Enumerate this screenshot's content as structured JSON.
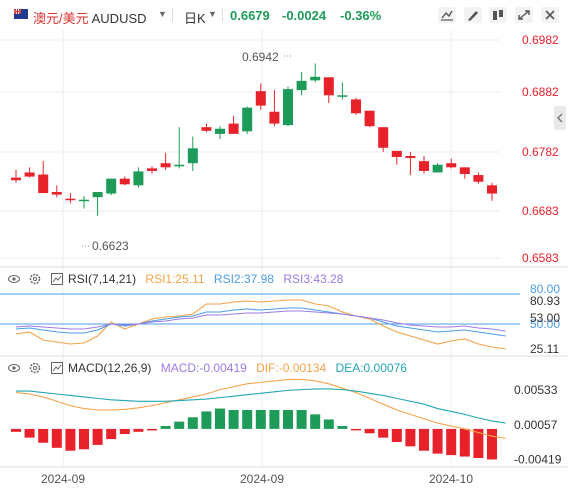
{
  "header": {
    "pair_cn": "澳元/美元",
    "pair_code": "AUDUSD",
    "period": "日K",
    "last": "0.6679",
    "change": "-0.0024",
    "change_pct": "-0.36%"
  },
  "colors": {
    "up": "#1e9b58",
    "down": "#e8222b",
    "grid": "#eeeeee"
  },
  "chart_data": [
    {
      "type": "candlestick",
      "title": "",
      "y_ticks": [
        "0.6982",
        "0.6882",
        "0.6782",
        "0.6683",
        "0.6583"
      ],
      "ylim": [
        0.6556,
        0.7003
      ],
      "annotations": {
        "high": "0.6942",
        "low": "0.6623"
      },
      "candles": [
        {
          "o": 0.672,
          "h": 0.6735,
          "l": 0.671,
          "c": 0.6715
        },
        {
          "o": 0.673,
          "h": 0.674,
          "l": 0.672,
          "c": 0.6722
        },
        {
          "o": 0.6726,
          "h": 0.6752,
          "l": 0.6715,
          "c": 0.669
        },
        {
          "o": 0.6692,
          "h": 0.6705,
          "l": 0.6682,
          "c": 0.6687
        },
        {
          "o": 0.6679,
          "h": 0.669,
          "l": 0.667,
          "c": 0.6678
        },
        {
          "o": 0.6675,
          "h": 0.6684,
          "l": 0.666,
          "c": 0.6677
        },
        {
          "o": 0.6682,
          "h": 0.669,
          "l": 0.6646,
          "c": 0.6692
        },
        {
          "o": 0.6689,
          "h": 0.6718,
          "l": 0.6686,
          "c": 0.6718
        },
        {
          "o": 0.6718,
          "h": 0.6722,
          "l": 0.6705,
          "c": 0.6707
        },
        {
          "o": 0.6705,
          "h": 0.674,
          "l": 0.67,
          "c": 0.6732
        },
        {
          "o": 0.6738,
          "h": 0.6742,
          "l": 0.6728,
          "c": 0.6733
        },
        {
          "o": 0.6748,
          "h": 0.6768,
          "l": 0.6735,
          "c": 0.674
        },
        {
          "o": 0.6742,
          "h": 0.6818,
          "l": 0.6738,
          "c": 0.6745
        },
        {
          "o": 0.6748,
          "h": 0.68,
          "l": 0.6733,
          "c": 0.6777
        },
        {
          "o": 0.6818,
          "h": 0.6825,
          "l": 0.6808,
          "c": 0.6811
        },
        {
          "o": 0.6805,
          "h": 0.682,
          "l": 0.6795,
          "c": 0.6815
        },
        {
          "o": 0.6825,
          "h": 0.684,
          "l": 0.6808,
          "c": 0.6805
        },
        {
          "o": 0.681,
          "h": 0.6858,
          "l": 0.6805,
          "c": 0.6856
        },
        {
          "o": 0.6888,
          "h": 0.6903,
          "l": 0.6852,
          "c": 0.686
        },
        {
          "o": 0.6848,
          "h": 0.689,
          "l": 0.682,
          "c": 0.6825
        },
        {
          "o": 0.6822,
          "h": 0.6897,
          "l": 0.682,
          "c": 0.6892
        },
        {
          "o": 0.689,
          "h": 0.6925,
          "l": 0.688,
          "c": 0.6908
        },
        {
          "o": 0.6909,
          "h": 0.6942,
          "l": 0.6905,
          "c": 0.6916
        },
        {
          "o": 0.6915,
          "h": 0.691,
          "l": 0.6865,
          "c": 0.688
        },
        {
          "o": 0.6878,
          "h": 0.6905,
          "l": 0.6872,
          "c": 0.688
        },
        {
          "o": 0.6872,
          "h": 0.6875,
          "l": 0.6842,
          "c": 0.6845
        },
        {
          "o": 0.685,
          "h": 0.685,
          "l": 0.6818,
          "c": 0.682
        },
        {
          "o": 0.6818,
          "h": 0.6818,
          "l": 0.677,
          "c": 0.6778
        },
        {
          "o": 0.6772,
          "h": 0.6772,
          "l": 0.6745,
          "c": 0.676
        },
        {
          "o": 0.6762,
          "h": 0.677,
          "l": 0.6725,
          "c": 0.6758
        },
        {
          "o": 0.6752,
          "h": 0.6762,
          "l": 0.6728,
          "c": 0.6733
        },
        {
          "o": 0.673,
          "h": 0.6748,
          "l": 0.673,
          "c": 0.6745
        },
        {
          "o": 0.6748,
          "h": 0.6757,
          "l": 0.6738,
          "c": 0.674
        },
        {
          "o": 0.674,
          "h": 0.674,
          "l": 0.6718,
          "c": 0.6727
        },
        {
          "o": 0.6725,
          "h": 0.673,
          "l": 0.6708,
          "c": 0.6712
        },
        {
          "o": 0.6705,
          "h": 0.671,
          "l": 0.6675,
          "c": 0.6689
        }
      ]
    },
    {
      "type": "line",
      "name_label": "RSI(7,14,21)",
      "legend": [
        "RSI1:25.11",
        "RSI2:37.98",
        "RSI3:43.28"
      ],
      "y_ticks": [
        "80.00",
        "80.93",
        "50.00",
        "53.00",
        "25.11"
      ],
      "ylim": [
        20,
        84
      ],
      "series": [
        {
          "color": "#f5a34a",
          "values": [
            40,
            42,
            34,
            32,
            30,
            31,
            38,
            52,
            45,
            50,
            55,
            57,
            58,
            60,
            70,
            70,
            72,
            73,
            72,
            73,
            74,
            74,
            70,
            68,
            62,
            58,
            55,
            48,
            42,
            38,
            34,
            30,
            33,
            35,
            30,
            27,
            25
          ]
        },
        {
          "color": "#4b9ce3",
          "values": [
            45,
            46,
            44,
            42,
            41,
            41,
            44,
            50,
            48,
            50,
            53,
            55,
            57,
            58,
            62,
            62,
            64,
            65,
            64,
            65,
            66,
            66,
            64,
            62,
            60,
            58,
            56,
            52,
            48,
            46,
            44,
            42,
            43,
            44,
            42,
            40,
            38
          ]
        },
        {
          "color": "#9b7be3",
          "values": [
            47,
            48,
            47,
            46,
            45,
            45,
            47,
            50,
            49,
            50,
            52,
            53,
            55,
            56,
            59,
            59,
            60,
            61,
            61,
            62,
            63,
            63,
            62,
            61,
            60,
            58,
            56,
            54,
            51,
            49,
            48,
            47,
            47,
            48,
            46,
            45,
            43
          ]
        }
      ]
    },
    {
      "type": "bar",
      "name_label": "MACD(12,26,9)",
      "legend": [
        "MACD:-0.00419",
        "DIF:-0.00134",
        "DEA:0.00076"
      ],
      "y_ticks": [
        "0.00533",
        "0.00057",
        "-0.00419"
      ],
      "ylim": [
        -0.0051,
        0.007
      ],
      "macd": [
        -0.0004,
        -0.0012,
        -0.0019,
        -0.0026,
        -0.003,
        -0.0028,
        -0.0022,
        -0.0014,
        -0.0007,
        -0.0004,
        -0.0002,
        0.0004,
        0.001,
        0.0016,
        0.0024,
        0.0028,
        0.0026,
        0.0026,
        0.0026,
        0.0026,
        0.0026,
        0.0026,
        0.002,
        0.0013,
        0.0004,
        -0.0002,
        -0.0006,
        -0.0012,
        -0.0018,
        -0.0024,
        -0.003,
        -0.0034,
        -0.0036,
        -0.0038,
        -0.004,
        -0.0042
      ],
      "dif": [
        0.005,
        0.0048,
        0.0044,
        0.0038,
        0.0032,
        0.0028,
        0.0026,
        0.0026,
        0.0027,
        0.0029,
        0.0032,
        0.0036,
        0.004,
        0.0044,
        0.0048,
        0.0054,
        0.0058,
        0.0062,
        0.0064,
        0.0066,
        0.0068,
        0.0068,
        0.0066,
        0.0062,
        0.0056,
        0.005,
        0.0042,
        0.0034,
        0.0026,
        0.002,
        0.0014,
        0.0008,
        0.0004,
        0.0,
        -0.0005,
        -0.001,
        -0.0013
      ],
      "dea": [
        0.0052,
        0.0052,
        0.005,
        0.0048,
        0.0046,
        0.0044,
        0.0042,
        0.004,
        0.0039,
        0.0038,
        0.0038,
        0.0038,
        0.0039,
        0.004,
        0.0041,
        0.0043,
        0.0045,
        0.0047,
        0.0049,
        0.0051,
        0.0053,
        0.0054,
        0.0055,
        0.0055,
        0.0054,
        0.0052,
        0.0049,
        0.0046,
        0.0042,
        0.0038,
        0.0034,
        0.0028,
        0.0024,
        0.002,
        0.0015,
        0.0011,
        0.0008
      ]
    }
  ],
  "x_ticks": [
    "2024-09",
    "2024-09",
    "2024-10"
  ]
}
